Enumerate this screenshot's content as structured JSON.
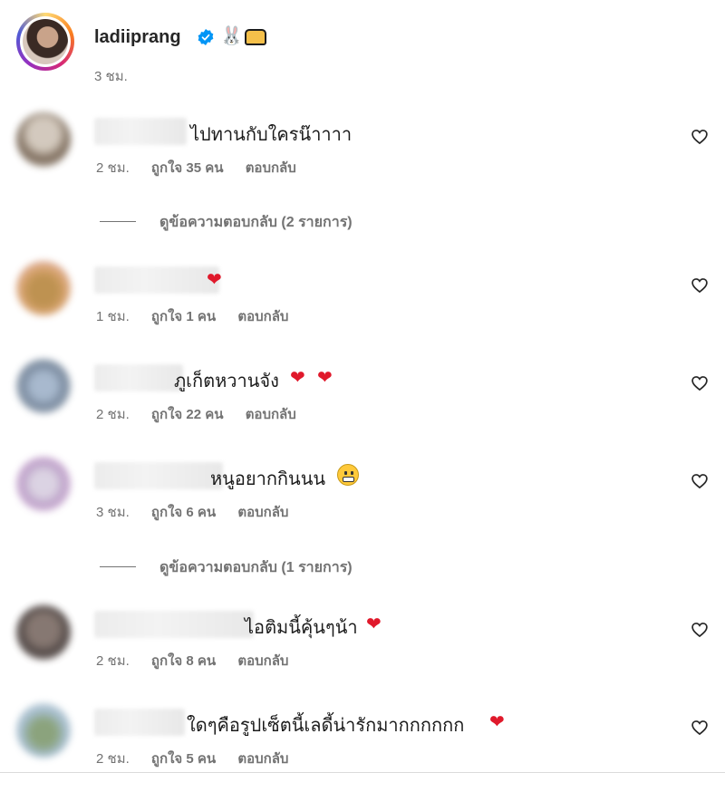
{
  "post": {
    "owner_username": "ladiiprang",
    "owner_emojis": [
      "rabbit-emoji",
      "bread-emoji"
    ],
    "time": "3 ชม.",
    "verified_color": "#0095f6"
  },
  "comments": [
    {
      "text": "ไปทานกับใครน๊าาาา",
      "time": "2 ชม.",
      "likes": "ถูกใจ 35 คน",
      "reply": "ตอบกลับ",
      "emoji": ""
    },
    {
      "text": "",
      "time": "1 ชม.",
      "likes": "ถูกใจ 1 คน",
      "reply": "ตอบกลับ",
      "emoji": "red-heart"
    },
    {
      "text": "ภูเก็ตหวานจัง",
      "time": "2 ชม.",
      "likes": "ถูกใจ 22 คน",
      "reply": "ตอบกลับ",
      "emoji": "red-heart x2"
    },
    {
      "text": "หนูอยากกินนน",
      "time": "3 ชม.",
      "likes": "ถูกใจ 6 คน",
      "reply": "ตอบกลับ",
      "emoji": "grimacing-face"
    },
    {
      "text": "ไอติมนี้คุ้นๆน้า",
      "time": "2 ชม.",
      "likes": "ถูกใจ 8 คน",
      "reply": "ตอบกลับ",
      "emoji": "red-heart"
    },
    {
      "text": "ใดๆคือรูปเซ็ตนี้เลดี้น่ารักมากกกกกก",
      "time": "2 ชม.",
      "likes": "ถูกใจ 5 คน",
      "reply": "ตอบกลับ",
      "emoji": "red-heart"
    }
  ],
  "view_replies": [
    {
      "label": "ดูข้อความตอบกลับ (2 รายการ)"
    },
    {
      "label": "ดูข้อความตอบกลับ (1 รายการ)"
    }
  ],
  "icons": {
    "like": "heart-outline-icon",
    "heart_emoji_color": "#e0192b"
  }
}
